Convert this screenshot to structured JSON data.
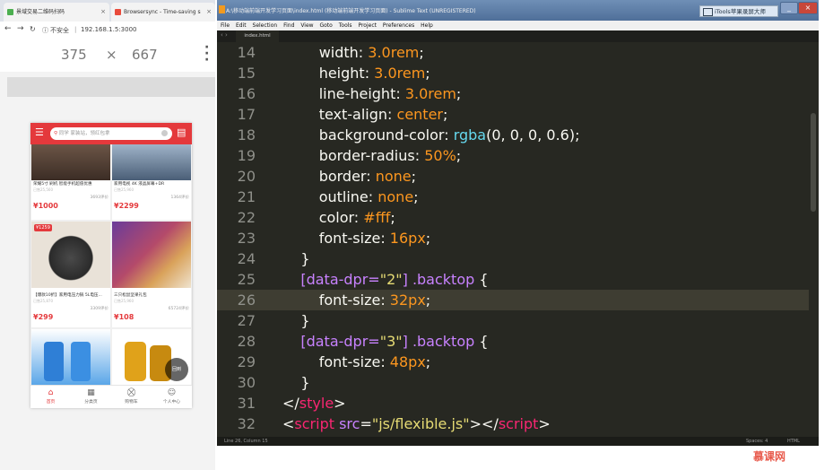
{
  "browser": {
    "tabs": [
      {
        "label": "景域交易二维码扫码",
        "color": "#4caf50"
      },
      {
        "label": "Browsersync - Time-saving s",
        "color": "#e94b3c"
      }
    ],
    "address": "192.168.1.5:3000",
    "security_label": "不安全",
    "viewport_width": "375",
    "viewport_x": "×",
    "viewport_height": "667"
  },
  "phone": {
    "search_placeholder": "同学 家装站，领红包拿",
    "products": [
      {
        "title": "荣耀5寸 刷机 智能手机超值优惠",
        "sub": "已售25,560",
        "price": "¥1000",
        "sold": "3693评价"
      },
      {
        "title": "家用电视 4K 液晶屏幕+DR",
        "sub": "已售25,960",
        "price": "¥2299",
        "sold": "1364评价"
      },
      {
        "title": "【爆款10折】家用电压力锅 5L电压...",
        "sub": "已售25,870",
        "price": "¥299",
        "sold": "3309评价"
      },
      {
        "title": "三只松鼠坚果礼包",
        "sub": "已售25,960",
        "price": "¥108",
        "sold": "65724评价"
      }
    ],
    "badge": "¥1259",
    "back_top": "回到",
    "tabs": [
      {
        "icon": "⌂",
        "label": "首页"
      },
      {
        "icon": "▦",
        "label": "分类页"
      },
      {
        "icon": "⛒",
        "label": "购物车"
      },
      {
        "icon": "☺",
        "label": "个人中心"
      }
    ]
  },
  "editor": {
    "title": "A:\\移动端前端开发学习页面\\index.html (移动端前端开发学习页面) - Sublime Text (UNREGISTERED)",
    "tools_label": "iTools苹果录屏大师",
    "menu": [
      "File",
      "Edit",
      "Selection",
      "Find",
      "View",
      "Goto",
      "Tools",
      "Project",
      "Preferences",
      "Help"
    ],
    "file_tab": "index.html",
    "status_left": "Line 26, Column 15",
    "status_right_1": "Spaces: 4",
    "status_right_2": "HTML",
    "lines": [
      {
        "n": "14",
        "segs": [
          [
            "w",
            "        width: "
          ],
          [
            "o",
            "3.0rem"
          ],
          [
            "w",
            ";"
          ]
        ]
      },
      {
        "n": "15",
        "segs": [
          [
            "w",
            "        height: "
          ],
          [
            "o",
            "3.0rem"
          ],
          [
            "w",
            ";"
          ]
        ]
      },
      {
        "n": "16",
        "segs": [
          [
            "w",
            "        line-height: "
          ],
          [
            "o",
            "3.0rem"
          ],
          [
            "w",
            ";"
          ]
        ]
      },
      {
        "n": "17",
        "segs": [
          [
            "w",
            "        text-align: "
          ],
          [
            "o",
            "center"
          ],
          [
            "w",
            ";"
          ]
        ]
      },
      {
        "n": "18",
        "segs": [
          [
            "w",
            "        background-color: "
          ],
          [
            "b",
            "rgba"
          ],
          [
            "w",
            "(0, 0, 0, 0.6);"
          ]
        ]
      },
      {
        "n": "19",
        "segs": [
          [
            "w",
            "        border-radius: "
          ],
          [
            "o",
            "50%"
          ],
          [
            "w",
            ";"
          ]
        ]
      },
      {
        "n": "20",
        "segs": [
          [
            "w",
            "        border: "
          ],
          [
            "o",
            "none"
          ],
          [
            "w",
            ";"
          ]
        ]
      },
      {
        "n": "21",
        "segs": [
          [
            "w",
            "        outline: "
          ],
          [
            "o",
            "none"
          ],
          [
            "w",
            ";"
          ]
        ]
      },
      {
        "n": "22",
        "segs": [
          [
            "w",
            "        color: "
          ],
          [
            "o",
            "#fff"
          ],
          [
            "w",
            ";"
          ]
        ]
      },
      {
        "n": "23",
        "segs": [
          [
            "w",
            "        font-size: "
          ],
          [
            "o",
            "16px"
          ],
          [
            "w",
            ";"
          ]
        ]
      },
      {
        "n": "24",
        "segs": [
          [
            "w",
            "    }"
          ]
        ]
      },
      {
        "n": "25",
        "segs": [
          [
            "w",
            "    "
          ],
          [
            "p",
            "[data-dpr="
          ],
          [
            "y",
            "\"2\""
          ],
          [
            "p",
            "] .backtop"
          ],
          [
            "w",
            " {"
          ]
        ]
      },
      {
        "n": "26",
        "segs": [
          [
            "w",
            "        font-size: "
          ],
          [
            "o",
            "32px"
          ],
          [
            "w",
            ";"
          ]
        ],
        "active": true
      },
      {
        "n": "27",
        "segs": [
          [
            "w",
            "    }"
          ]
        ]
      },
      {
        "n": "28",
        "segs": [
          [
            "w",
            "    "
          ],
          [
            "p",
            "[data-dpr="
          ],
          [
            "y",
            "\"3\""
          ],
          [
            "p",
            "] .backtop"
          ],
          [
            "w",
            " {"
          ]
        ]
      },
      {
        "n": "29",
        "segs": [
          [
            "w",
            "        font-size: "
          ],
          [
            "o",
            "48px"
          ],
          [
            "w",
            ";"
          ]
        ]
      },
      {
        "n": "30",
        "segs": [
          [
            "w",
            "    }"
          ]
        ]
      },
      {
        "n": "31",
        "segs": [
          [
            "w",
            "</"
          ],
          [
            "r",
            "style"
          ],
          [
            "w",
            ">"
          ]
        ]
      },
      {
        "n": "32",
        "segs": [
          [
            "w",
            "<"
          ],
          [
            "r",
            "script"
          ],
          [
            "w",
            " "
          ],
          [
            "p",
            "src"
          ],
          [
            "w",
            "="
          ],
          [
            "y",
            "\"js/flexible.js\""
          ],
          [
            "w",
            "></"
          ],
          [
            "r",
            "script"
          ],
          [
            "w",
            ">"
          ]
        ]
      }
    ]
  },
  "watermark": "慕课网"
}
